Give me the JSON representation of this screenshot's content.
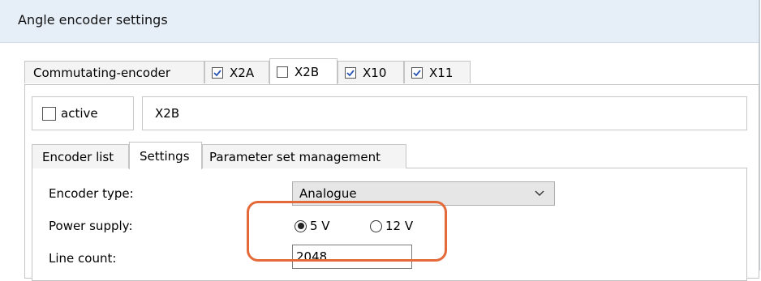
{
  "window": {
    "title": "Angle encoder settings"
  },
  "top_tabs": [
    {
      "label": "Commutating-encoder",
      "checked": null,
      "selected": false
    },
    {
      "label": "X2A",
      "checked": true,
      "selected": false
    },
    {
      "label": "X2B",
      "checked": false,
      "selected": true
    },
    {
      "label": "X10",
      "checked": true,
      "selected": false
    },
    {
      "label": "X11",
      "checked": true,
      "selected": false
    }
  ],
  "active_checkbox": {
    "label": "active",
    "checked": false
  },
  "encoder_name": "X2B",
  "inner_tabs": [
    {
      "label": "Encoder list",
      "selected": false
    },
    {
      "label": "Settings",
      "selected": true
    },
    {
      "label": "Parameter set management",
      "selected": false
    }
  ],
  "settings": {
    "encoder_type_label": "Encoder type:",
    "encoder_type_value": "Analogue",
    "power_supply_label": "Power supply:",
    "power_supply_options": [
      {
        "label": "5 V",
        "selected": true
      },
      {
        "label": "12 V",
        "selected": false
      }
    ],
    "line_count_label": "Line count:",
    "line_count_value": "2048"
  },
  "colors": {
    "highlight": "#e46a3a",
    "titlebar": "#e6eef8"
  }
}
